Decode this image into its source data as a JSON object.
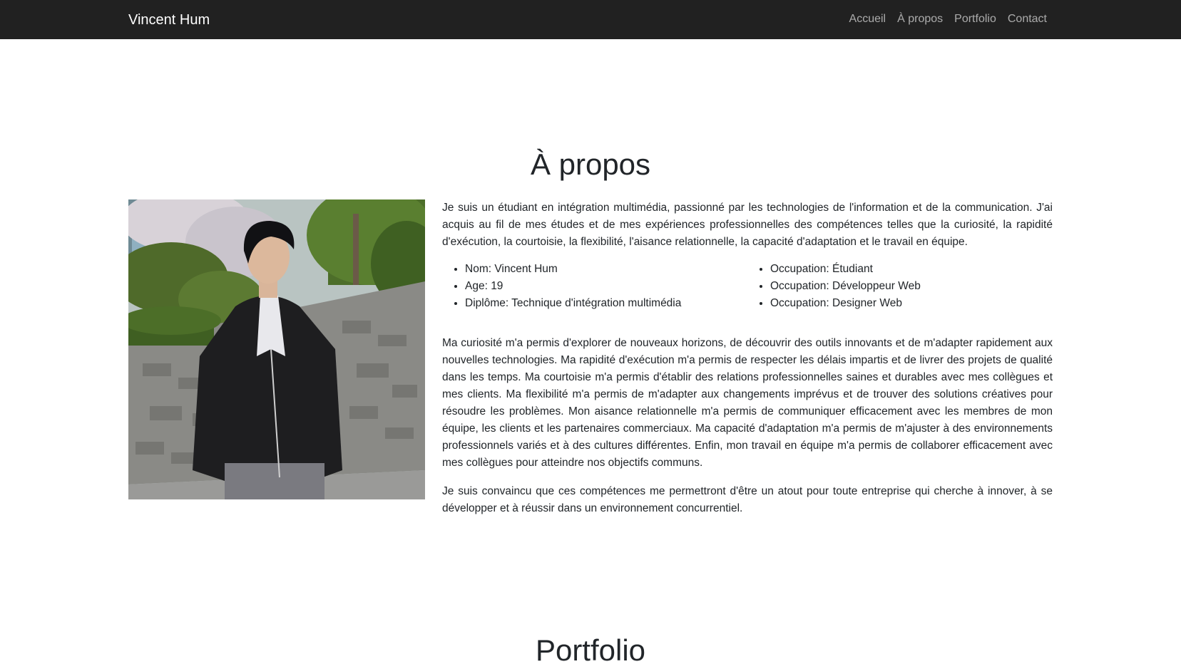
{
  "navbar": {
    "brand": "Vincent Hum",
    "links": [
      "Accueil",
      "À propos",
      "Portfolio",
      "Contact"
    ]
  },
  "about": {
    "title": "À propos",
    "photo_alt": "portrait-photo",
    "intro": "Je suis un étudiant en intégration multimédia, passionné par les technologies de l'information et de la communication. J'ai acquis au fil de mes études et de mes expériences professionnelles des compétences telles que la curiosité, la rapidité d'exécution, la courtoisie, la flexibilité, l'aisance relationnelle, la capacité d'adaptation et le travail en équipe.",
    "info_left": [
      "Nom: Vincent Hum",
      "Age: 19",
      "Diplôme: Technique d'intégration multimédia"
    ],
    "info_right": [
      "Occupation: Étudiant",
      "Occupation: Développeur Web",
      "Occupation: Designer Web"
    ],
    "paragraph2": "Ma curiosité m'a permis d'explorer de nouveaux horizons, de découvrir des outils innovants et de m'adapter rapidement aux nouvelles technologies. Ma rapidité d'exécution m'a permis de respecter les délais impartis et de livrer des projets de qualité dans les temps. Ma courtoisie m'a permis d'établir des relations professionnelles saines et durables avec mes collègues et mes clients. Ma flexibilité m'a permis de m'adapter aux changements imprévus et de trouver des solutions créatives pour résoudre les problèmes. Mon aisance relationnelle m'a permis de communiquer efficacement avec les membres de mon équipe, les clients et les partenaires commerciaux. Ma capacité d'adaptation m'a permis de m'ajuster à des environnements professionnels variés et à des cultures différentes. Enfin, mon travail en équipe m'a permis de collaborer efficacement avec mes collègues pour atteindre nos objectifs communs.",
    "paragraph3": "Je suis convaincu que ces compétences me permettront d'être un atout pour toute entreprise qui cherche à innover, à se développer et à réussir dans un environnement concurrentiel."
  },
  "portfolio": {
    "title": "Portfolio"
  },
  "colors": {
    "navbar_bg": "#212121",
    "nav_link": "rgba(255,255,255,0.62)",
    "text": "#212529"
  }
}
